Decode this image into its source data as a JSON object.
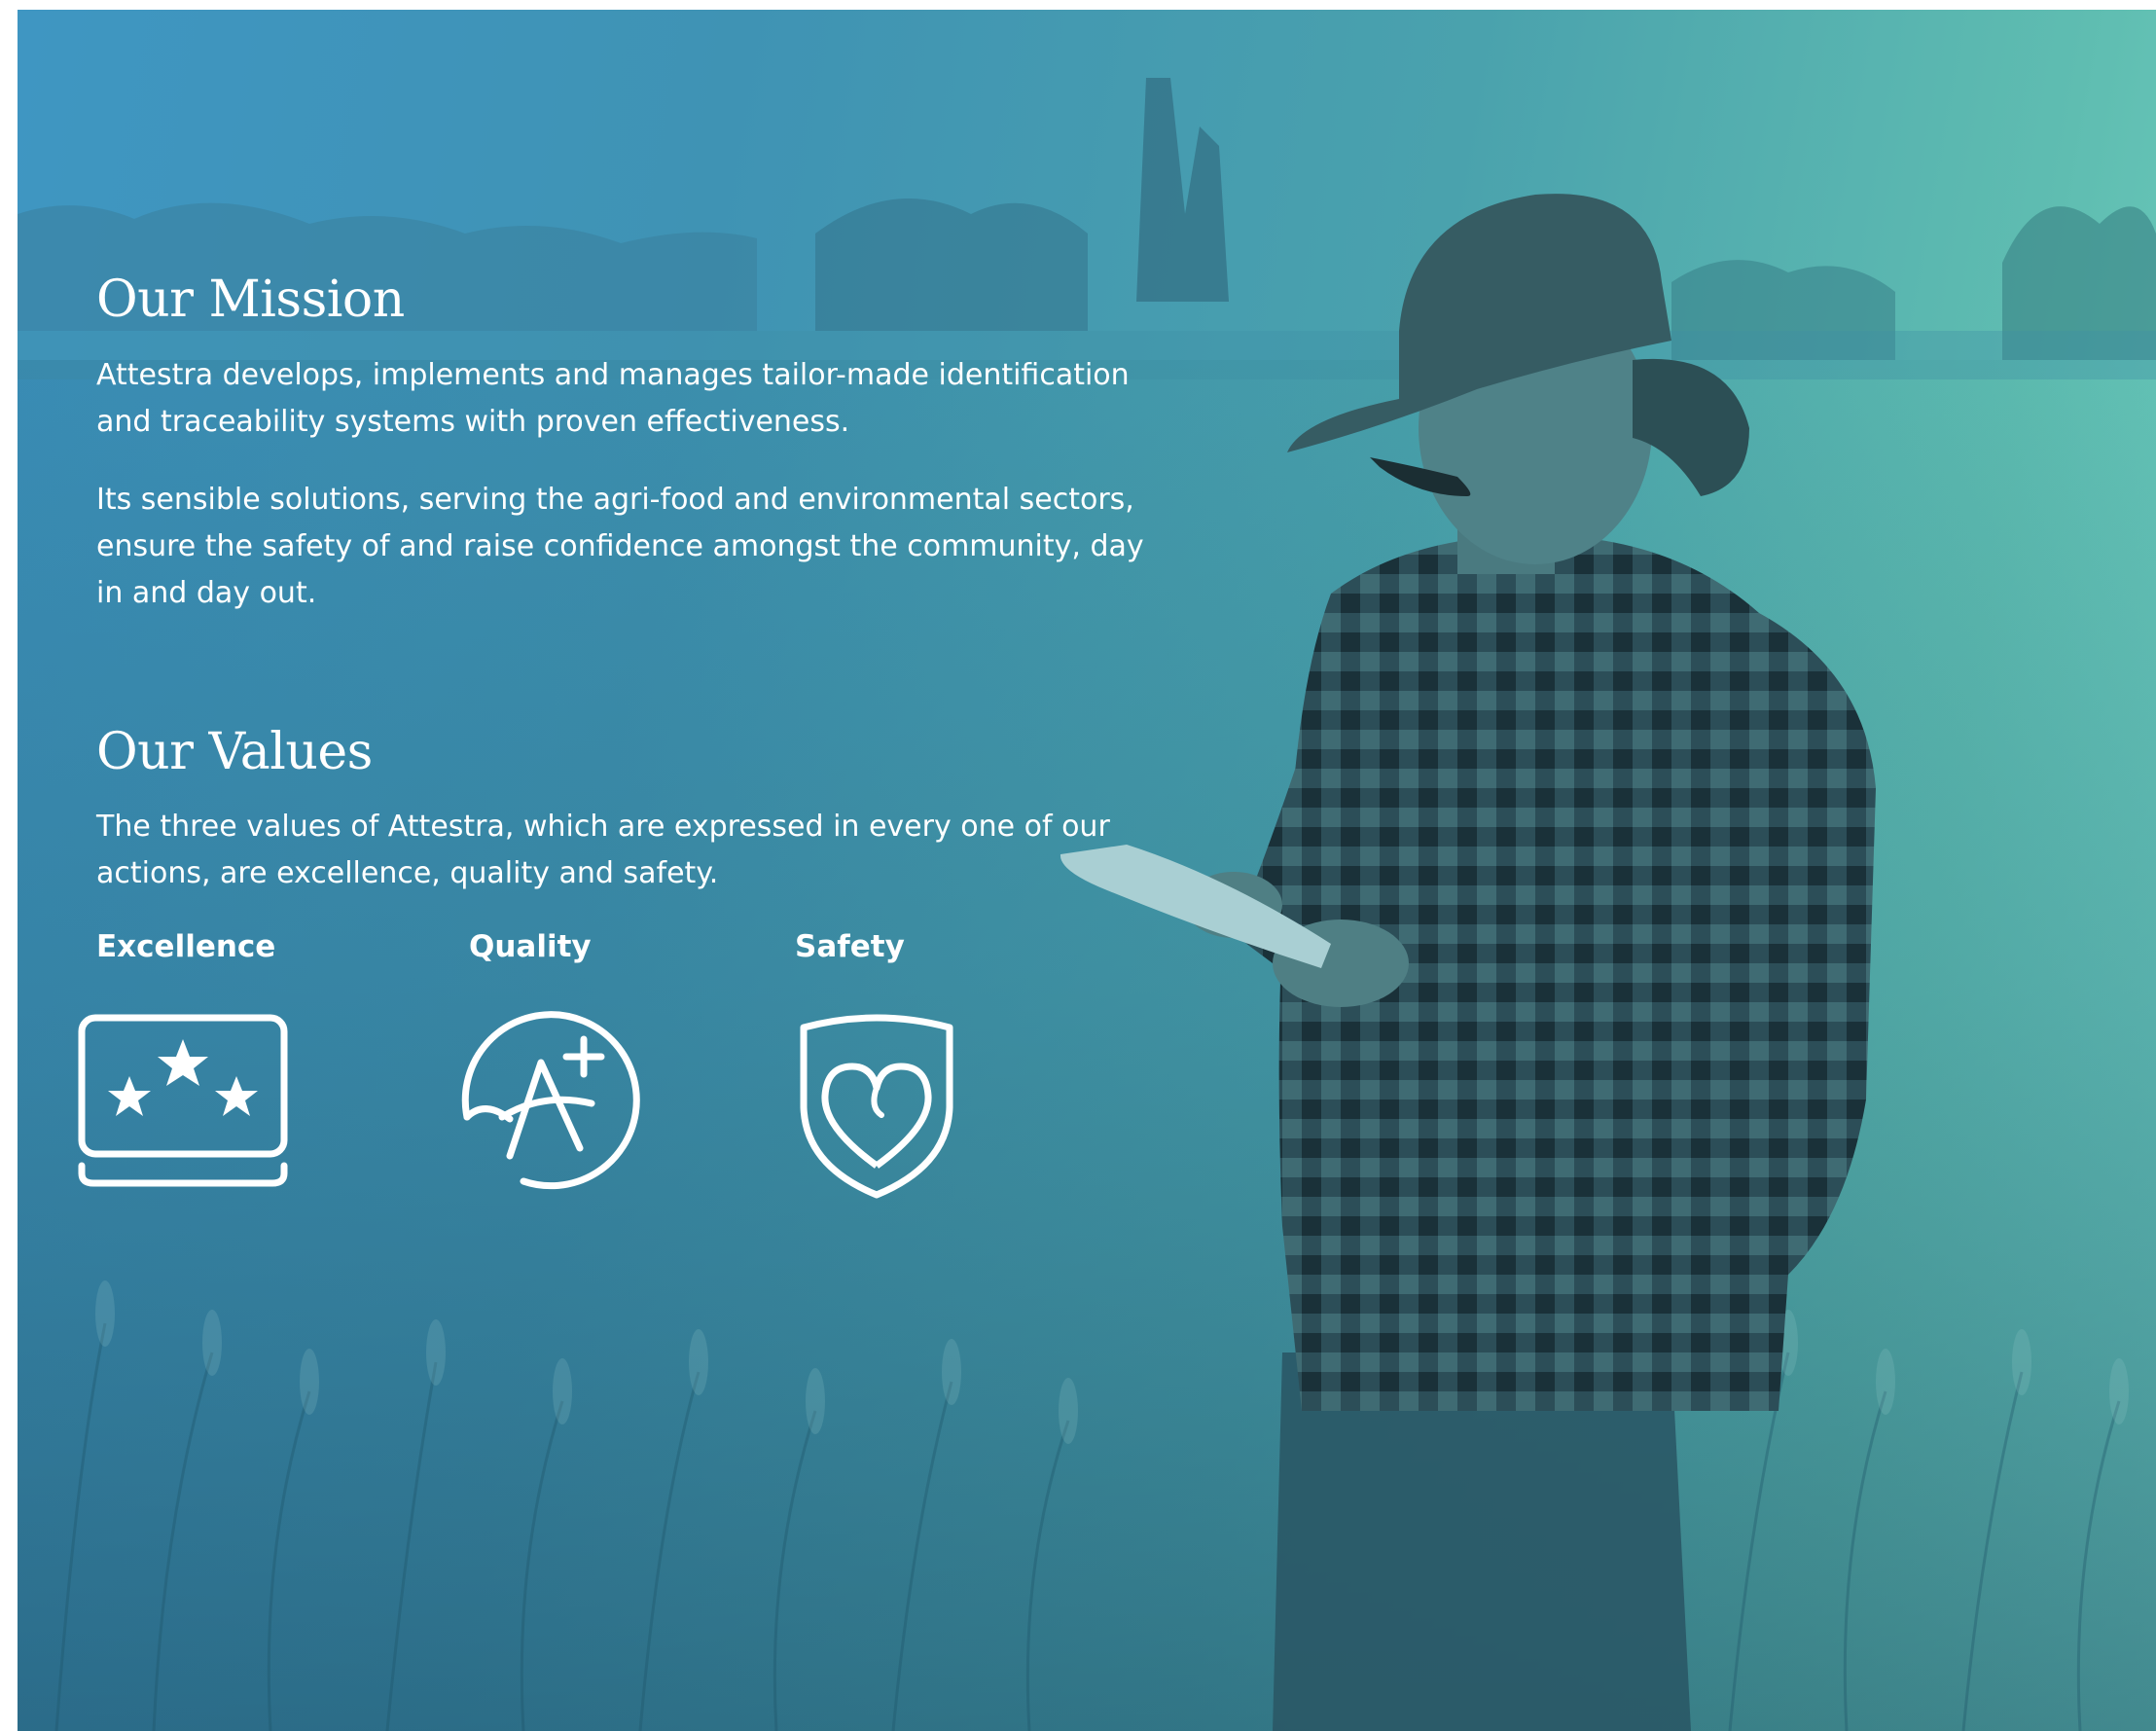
{
  "mission": {
    "title": "Our Mission",
    "paragraph_1": "Attestra develops, implements and manages tailor-made identification and traceability systems with proven effectiveness.",
    "paragraph_2": "Its sensible solutions, serving the agri-food and environmental sectors, ensure the safety of and raise confidence amongst the community, day in and day out."
  },
  "values": {
    "title": "Our Values",
    "intro": "The three values of Attestra, which are expressed in every one of our actions, are excellence, quality and safety.",
    "items": [
      {
        "label": "Excellence",
        "icon": "stars-screen-icon"
      },
      {
        "label": "Quality",
        "icon": "a-plus-grade-icon"
      },
      {
        "label": "Safety",
        "icon": "shield-heart-icon"
      }
    ]
  },
  "colors": {
    "overlay_gradient_start": "#3f96c2",
    "overlay_gradient_end": "#6fcfc0",
    "text": "#ffffff"
  }
}
